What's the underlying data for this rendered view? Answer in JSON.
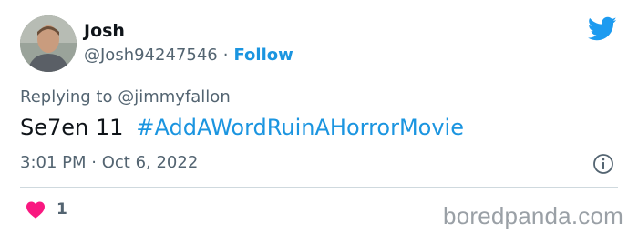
{
  "author": {
    "name": "Josh",
    "handle": "@Josh94247546",
    "separator": "·",
    "follow_label": "Follow"
  },
  "reply": {
    "prefix": "Replying to",
    "mention": "@jimmyfallon"
  },
  "tweet": {
    "text": "Se7en 11",
    "hashtag": "#AddAWordRuinAHorrorMovie"
  },
  "meta": {
    "time": "3:01 PM",
    "separator": "·",
    "date": "Oct 6, 2022"
  },
  "engagement": {
    "likes": "1"
  },
  "watermark": "boredpanda.com",
  "colors": {
    "accent": "#1b95e0",
    "heart": "#f91880",
    "muted": "#536471",
    "text": "#0f1419"
  },
  "icons": {
    "brand": "twitter-bird-icon",
    "info": "info-icon",
    "like": "heart-icon"
  }
}
